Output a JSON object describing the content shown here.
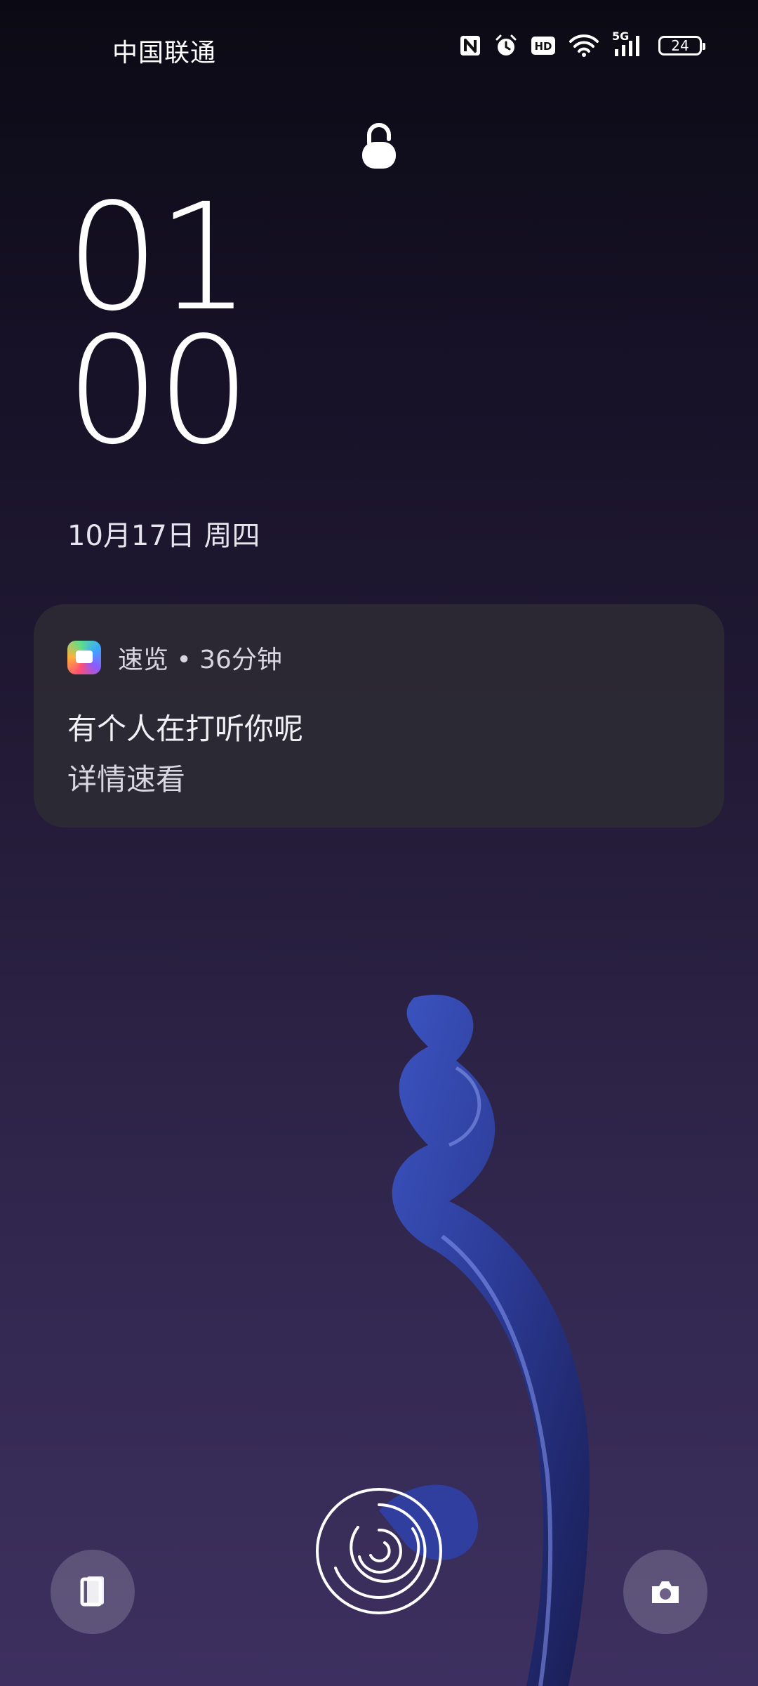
{
  "status_bar": {
    "carrier": "中国联通",
    "network": "5G",
    "battery_level": "24",
    "icons": [
      "nfc-icon",
      "alarm-icon",
      "hd-icon",
      "wifi-icon",
      "signal-5g-icon",
      "battery-icon"
    ]
  },
  "lock": {
    "icon": "lock-icon"
  },
  "clock": {
    "hours": "01",
    "minutes": "00"
  },
  "date": {
    "text": "10月17日 周四"
  },
  "notification": {
    "app_icon": "quick-view-app-icon",
    "header": "速览 • 36分钟",
    "title": "有个人在打听你呢",
    "body": "详情速看"
  },
  "bottom_controls": {
    "left_icon": "wallet-icon",
    "center_icon": "fingerprint-icon",
    "right_icon": "camera-icon"
  },
  "colors": {
    "background_top": "#0b0a14",
    "background_bottom": "#3d3060",
    "notification_bg": "#2c2a34",
    "text_primary": "#ffffff"
  }
}
